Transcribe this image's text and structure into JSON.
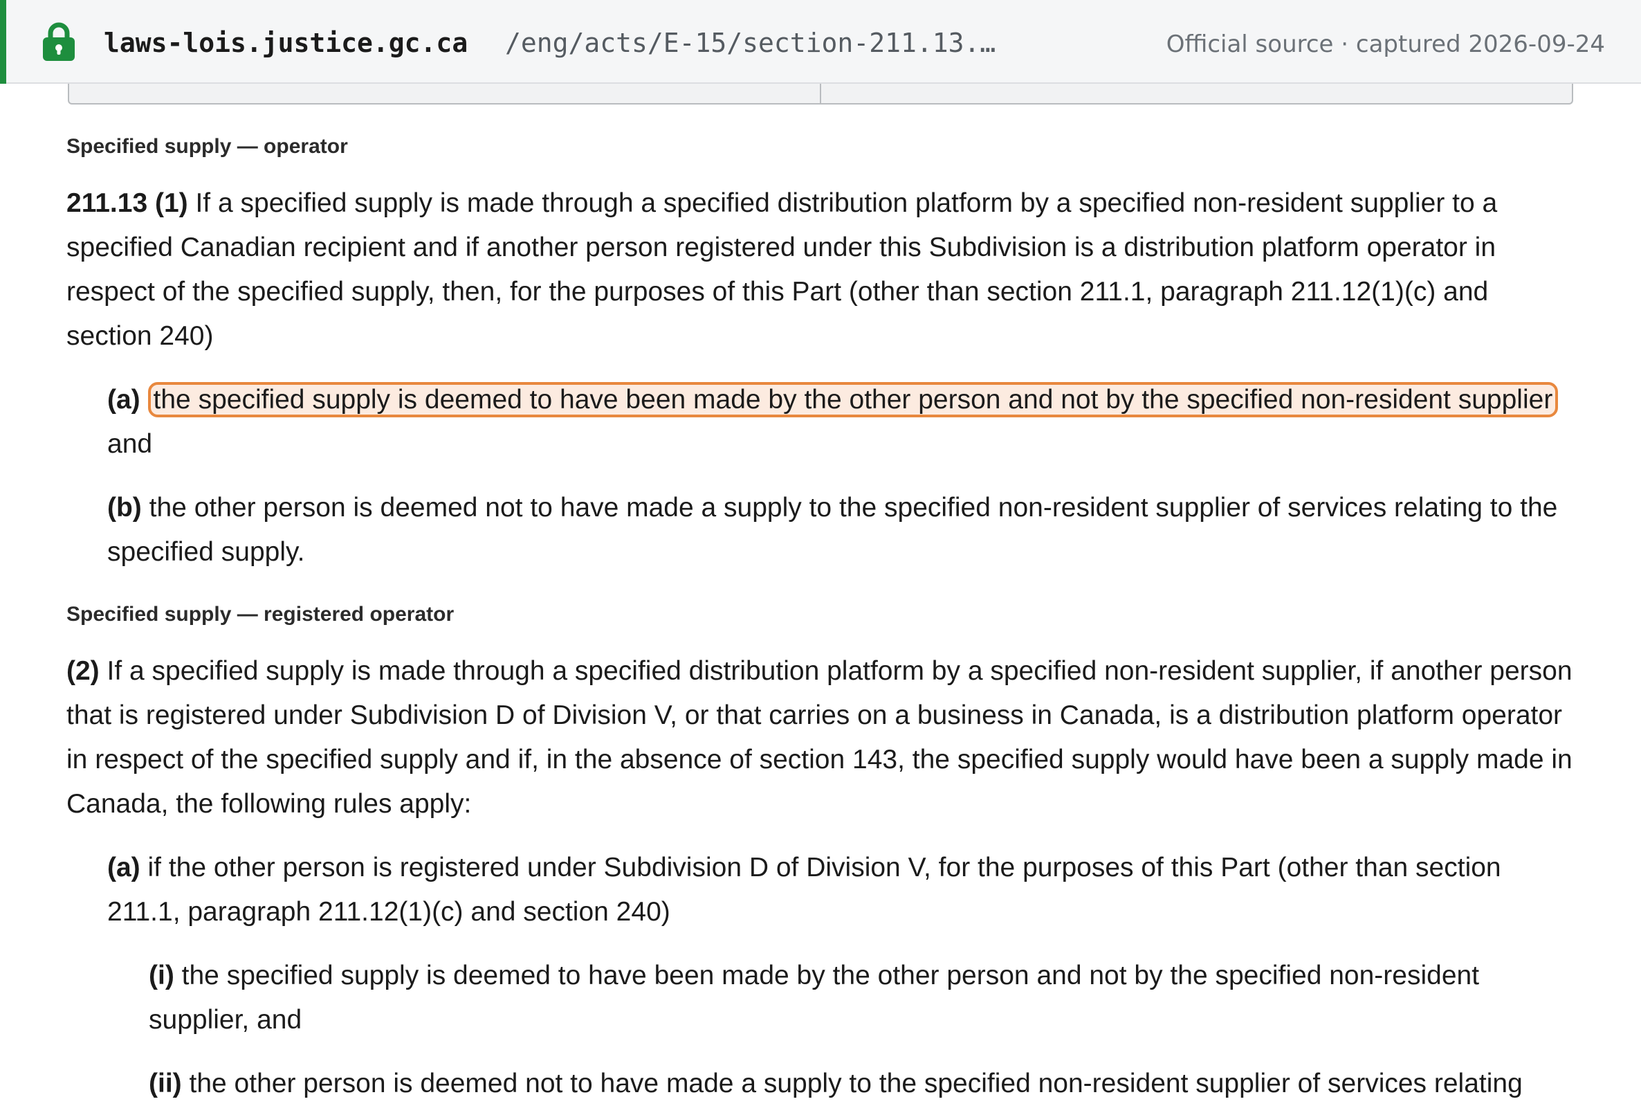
{
  "address_bar": {
    "lock_icon": "lock-icon",
    "domain": "laws-lois.justice.gc.ca",
    "path": "/eng/acts/E-15/section-211.13.…",
    "source_info": "Official source · captured 2026-09-24",
    "secure_color": "#1e8e3e"
  },
  "highlight_color": "#e8883e",
  "subsection1": {
    "marginal_note": "Specified supply — operator",
    "label": "211.13 (1)",
    "text": " If a specified supply is made through a specified distribution platform by a specified non-resident supplier to a specified Canadian recipient and if another person registered under this Subdivision is a distribution platform operator in respect of the specified supply, then, for the purposes of this Part (other than section 211.1, paragraph 211.12(1)(c) and section 240)",
    "paragraph_a": {
      "label": "(a)",
      "highlighted_text": "the specified supply is deemed to have been made by the other person and not by the specified non-resident supplier",
      "tail": " and"
    },
    "paragraph_b": {
      "label": "(b)",
      "text": " the other person is deemed not to have made a supply to the specified non-resident supplier of services relating to the specified supply."
    }
  },
  "subsection2": {
    "marginal_note": "Specified supply — registered operator",
    "label": "(2)",
    "text": " If a specified supply is made through a specified distribution platform by a specified non-resident supplier, if another person that is registered under Subdivision D of Division V, or that carries on a business in Canada, is a distribution platform operator in respect of the specified supply and if, in the absence of section 143, the specified supply would have been a supply made in Canada, the following rules apply:",
    "paragraph_a": {
      "label": "(a)",
      "text": " if the other person is registered under Subdivision D of Division V, for the purposes of this Part (other than section 211.1, paragraph 211.12(1)(c) and section 240)",
      "subparagraph_i": {
        "label": "(i)",
        "text": " the specified supply is deemed to have been made by the other person and not by the specified non-resident supplier, and"
      },
      "subparagraph_ii": {
        "label": "(ii)",
        "text": " the other person is deemed not to have made a supply to the specified non-resident supplier of services relating"
      }
    }
  }
}
